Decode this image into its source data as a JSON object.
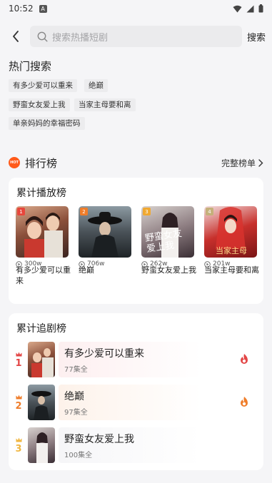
{
  "status": {
    "time": "10:52",
    "notif_letter": "A"
  },
  "search": {
    "placeholder": "搜索热播短剧",
    "button": "搜索"
  },
  "hot_search": {
    "title": "热门搜索",
    "tags": [
      "有多少爱可以重来",
      "绝巅",
      "野蛮女友爱上我",
      "当家主母要和离",
      "单亲妈妈的幸福密码"
    ]
  },
  "ranking": {
    "title": "排行榜",
    "badge": "HOT",
    "full_list": "完整榜单",
    "play": {
      "title": "累计播放榜",
      "items": [
        {
          "rank": "1",
          "name": "有多少爱可以重来",
          "count": "300w",
          "cover_text": "",
          "badge_color": "#e8473c"
        },
        {
          "rank": "2",
          "name": "绝巅",
          "count": "706w",
          "cover_text": "",
          "badge_color": "#ef7d2a"
        },
        {
          "rank": "3",
          "name": "野蛮女友爱上我",
          "count": "262w",
          "cover_text": "野蛮女友爱上我",
          "badge_color": "#f0a830"
        },
        {
          "rank": "4",
          "name": "当家主母要和离",
          "count": "201w",
          "cover_text": "当家主母",
          "badge_color": "#c5b07a"
        }
      ]
    },
    "follow": {
      "title": "累计追剧榜",
      "items": [
        {
          "rank": "1",
          "name": "有多少爱可以重来",
          "eps": "77集全",
          "color": "#e34646",
          "crown": "#e34646",
          "bg": "#fdeff0"
        },
        {
          "rank": "2",
          "name": "绝巅",
          "eps": "97集全",
          "color": "#ef7d2a",
          "crown": "#ef7d2a",
          "bg": "#fdf2ea"
        },
        {
          "rank": "3",
          "name": "野蛮女友爱上我",
          "eps": "100集全",
          "color": "#f0b640",
          "crown": "#f0b640",
          "bg": "#f6f6f8"
        }
      ]
    }
  },
  "colors": {
    "accent": "#ff5a1a",
    "page_bg": "#f5f5f7"
  }
}
